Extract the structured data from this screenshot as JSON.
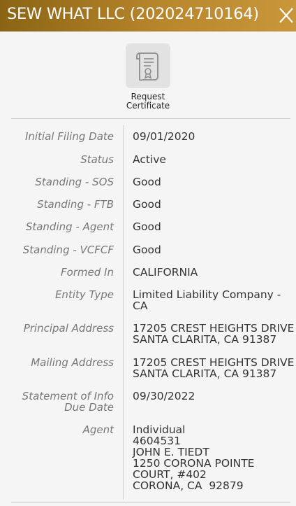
{
  "header": {
    "title": "SEW WHAT LLC (202024710164)",
    "close_icon": "close-icon",
    "colors": {
      "gradient_start": "#8a6414",
      "gradient_end": "#c9973a"
    }
  },
  "certificate": {
    "icon": "certificate-document-icon",
    "label_line1": "Request",
    "label_line2": "Certificate"
  },
  "details": [
    {
      "label": "Initial Filing Date",
      "value": [
        "09/01/2020"
      ]
    },
    {
      "label": "Status",
      "value": [
        "Active"
      ]
    },
    {
      "label": "Standing - SOS",
      "value": [
        "Good"
      ]
    },
    {
      "label": "Standing - FTB",
      "value": [
        "Good"
      ]
    },
    {
      "label": "Standing - Agent",
      "value": [
        "Good"
      ]
    },
    {
      "label": "Standing - VCFCF",
      "value": [
        "Good"
      ]
    },
    {
      "label": "Formed In",
      "value": [
        "CALIFORNIA"
      ]
    },
    {
      "label": "Entity Type",
      "value": [
        "Limited Liability Company -",
        "CA"
      ]
    },
    {
      "label": "Principal Address",
      "value": [
        "17205 CREST HEIGHTS DRIVE",
        "SANTA CLARITA, CA 91387"
      ]
    },
    {
      "label": "Mailing Address",
      "value": [
        "17205 CREST HEIGHTS DRIVE",
        "SANTA CLARITA, CA 91387"
      ]
    },
    {
      "label_lines": [
        "Statement of Info",
        "Due Date"
      ],
      "value": [
        "09/30/2022"
      ]
    },
    {
      "label": "Agent",
      "value": [
        "Individual",
        "4604531",
        "JOHN E. TIEDT",
        "1250 CORONA POINTE",
        "COURT, #402",
        "CORONA, CA  92879"
      ]
    }
  ]
}
